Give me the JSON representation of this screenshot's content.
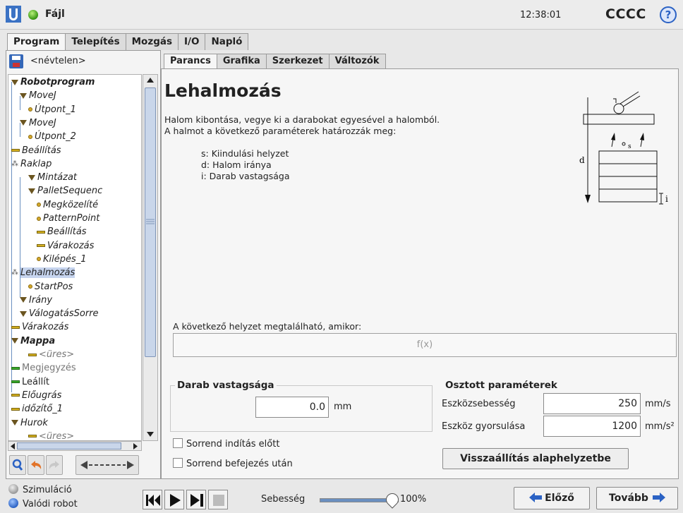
{
  "topbar": {
    "file_label": "Fájl",
    "clock": "12:38:01",
    "robot_name": "CCCC",
    "help": "?"
  },
  "main_tabs": [
    "Program",
    "Telepítés",
    "Mozgás",
    "I/O",
    "Napló"
  ],
  "program_name": "<névtelen>",
  "tree": [
    {
      "label": "Robotprogram",
      "icon": "triangle-icon",
      "bold": true
    },
    {
      "label": "MoveJ",
      "icon": "triangle-icon"
    },
    {
      "label": "Útpont_1",
      "icon": "waypoint-icon"
    },
    {
      "label": "MoveJ",
      "icon": "triangle-icon"
    },
    {
      "label": "Útpont_2",
      "icon": "waypoint-icon"
    },
    {
      "label": "Beállítás",
      "icon": "bar-icon"
    },
    {
      "label": "Raklap",
      "icon": "pallet-icon"
    },
    {
      "label": "Mintázat",
      "icon": "triangle-icon"
    },
    {
      "label": "PalletSequenc",
      "icon": "triangle-icon"
    },
    {
      "label": "Megközelíté",
      "icon": "waypoint-icon"
    },
    {
      "label": "PatternPoint",
      "icon": "waypoint-icon"
    },
    {
      "label": "Beállítás",
      "icon": "bar-icon"
    },
    {
      "label": "Várakozás",
      "icon": "bar-icon"
    },
    {
      "label": "Kilépés_1",
      "icon": "waypoint-icon"
    },
    {
      "label": "Lehalmozás",
      "icon": "pallet-icon",
      "selected": true
    },
    {
      "label": "StartPos",
      "icon": "waypoint-icon"
    },
    {
      "label": "Irány",
      "icon": "triangle-icon"
    },
    {
      "label": "VálogatásSorre",
      "icon": "triangle-icon"
    },
    {
      "label": "Várakozás",
      "icon": "bar-icon"
    },
    {
      "label": "Mappa",
      "icon": "triangle-icon",
      "bold": true
    },
    {
      "label": "<üres>",
      "icon": "bar-icon",
      "grey": true
    },
    {
      "label": "Megjegyzés",
      "icon": "green-bar-icon",
      "grey": true,
      "normal": true
    },
    {
      "label": "Leállít",
      "icon": "green-bar-icon",
      "normal": true
    },
    {
      "label": "Előugrás",
      "icon": "bar-icon"
    },
    {
      "label": "időzítő_1",
      "icon": "bar-icon"
    },
    {
      "label": "Hurok",
      "icon": "triangle-icon"
    },
    {
      "label": "<üres>",
      "icon": "bar-icon",
      "grey": true
    }
  ],
  "sub_tabs": [
    "Parancs",
    "Grafika",
    "Szerkezet",
    "Változók"
  ],
  "command": {
    "title": "Lehalmozás",
    "desc_line1": "Halom kibontása, vegye ki a darabokat egyesével a halomból.",
    "desc_line2": "A halmot a következő paraméterek határozzák meg:",
    "param_s": "s: Kiindulási helyzet",
    "param_d": "d: Halom iránya",
    "param_i": "i: Darab vastagsága",
    "diagram_d": "d",
    "diagram_s": "s",
    "diagram_i": "i",
    "next_label": "A következő helyzet megtalálható, amikor:",
    "fx_placeholder": "f(x)",
    "thickness_title": "Darab vastagsága",
    "thickness_value": "0.0",
    "thickness_unit": "mm",
    "shared_title": "Osztott paraméterek",
    "tool_speed_label": "Eszközsebesség",
    "tool_speed_value": "250",
    "tool_speed_unit": "mm/s",
    "tool_accel_label": "Eszköz gyorsulása",
    "tool_accel_value": "1200",
    "tool_accel_unit": "mm/s²",
    "check_start": "Sorrend indítás előtt",
    "check_end": "Sorrend befejezés után",
    "reset_button": "Visszaállítás alaphelyzetbe"
  },
  "bottombar": {
    "sim_label": "Szimuláció",
    "real_label": "Valódi robot",
    "speed_label": "Sebesség",
    "speed_value": "100%",
    "speed_fraction": 1.0,
    "prev_button": "Előző",
    "next_button": "Tovább"
  },
  "colors": {
    "accent": "#2b62c4",
    "selection": "#c6d4ee",
    "tree_icon": "#d4a82a"
  }
}
